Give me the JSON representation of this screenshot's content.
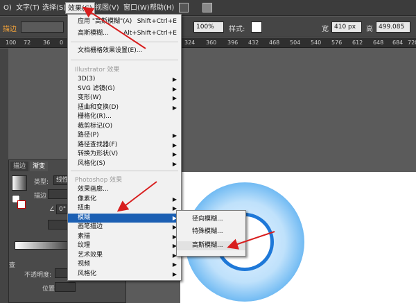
{
  "menubar": {
    "items": [
      "O)",
      "文字(T)",
      "选择(S)",
      "效果(C)",
      "视图(V)",
      "窗口(W)",
      "帮助(H)"
    ],
    "active": "效果(C)"
  },
  "control": {
    "stroke_label": "描边",
    "zoom_value": "100%",
    "style_label": "样式:",
    "width_value": "410 px",
    "height_value": "499.085",
    "w_label": "宽",
    "h_label": "高"
  },
  "ruler": [
    "100",
    "72",
    "36",
    "0",
    "6",
    "2",
    "324",
    "360",
    "396",
    "432",
    "468",
    "504",
    "540",
    "576",
    "612",
    "648",
    "684",
    "720"
  ],
  "panel": {
    "tabs": [
      "描边",
      "渐变"
    ],
    "type_label": "类型:",
    "type_value": "线性",
    "stroke_label": "描边",
    "angle_label": "∠",
    "angle_value": "0°",
    "opacity_label": "不透明度:",
    "position_label": "位置:",
    "side_label": "查"
  },
  "effect_menu": {
    "apply_label": "应用 \"高斯模糊\"(A)",
    "apply_shortcut": "Shift+Ctrl+E",
    "last_label": "高斯模糊...",
    "last_shortcut": "Alt+Shift+Ctrl+E",
    "doc_raster": "文档栅格效果设置(E)...",
    "illustrator_section": "Illustrator 效果",
    "illustrator_items": [
      "3D(3)",
      "SVG 滤镜(G)",
      "变形(W)",
      "扭曲和变换(D)",
      "栅格化(R)...",
      "裁剪标记(O)",
      "路径(P)",
      "路径查找器(F)",
      "转换为形状(V)",
      "风格化(S)"
    ],
    "photoshop_section": "Photoshop 效果",
    "photoshop_items": [
      "效果画廊...",
      "像素化",
      "扭曲",
      "模糊",
      "画笔描边",
      "素描",
      "纹理",
      "艺术效果",
      "视频",
      "风格化"
    ],
    "highlighted": "模糊"
  },
  "blur_menu": {
    "items": [
      "径向模糊...",
      "特殊模糊...",
      "高斯模糊..."
    ],
    "highlighted": "高斯模糊..."
  },
  "colors": {
    "highlight": "#1b5fb3",
    "arrow": "#d81e1e",
    "ring_blue": "#1e78d8"
  }
}
